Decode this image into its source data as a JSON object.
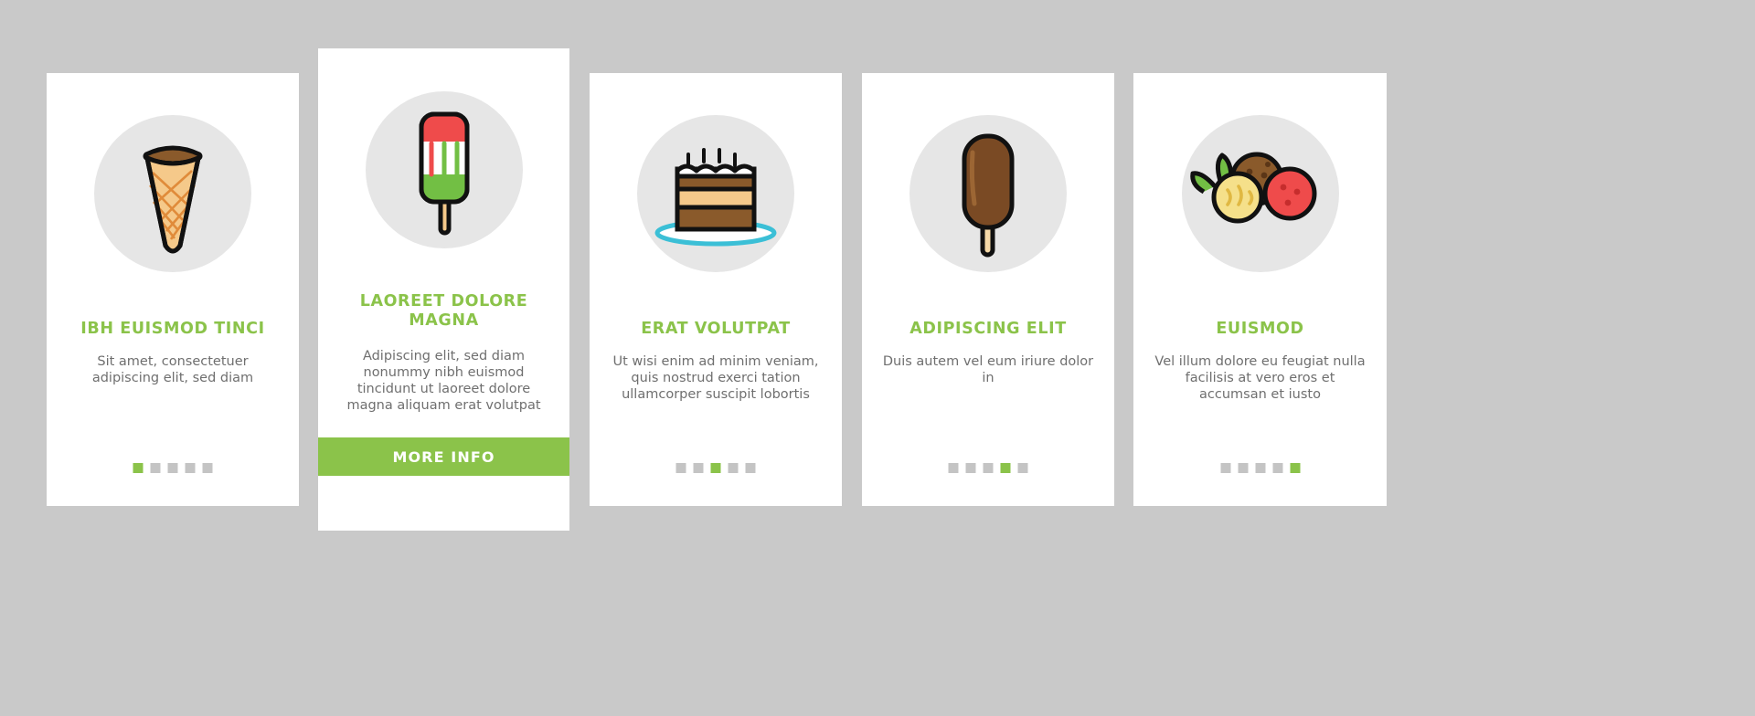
{
  "page": {
    "background_color": "#c9c9c9",
    "accent_color": "#8bc34a",
    "card_background": "#ffffff",
    "icon_circle_color": "#e6e6e6",
    "body_text_color": "#6f6f6f",
    "dot_inactive_color": "#c4c4c4"
  },
  "cards": [
    {
      "id": "card-1",
      "icon": "waffle-ice-cream-cone-icon",
      "title": "IBH EUISMOD TINCI",
      "body": "Sit amet, consectetuer adipiscing elit, sed diam",
      "dots": {
        "count": 5,
        "active_index": 0
      },
      "button": null
    },
    {
      "id": "card-2",
      "icon": "popsicle-ice-lolly-icon",
      "title": "LAOREET DOLORE MAGNA",
      "body": "Adipiscing elit, sed diam nonummy nibh euismod tincidunt ut laoreet dolore magna aliquam erat volutpat",
      "dots": null,
      "button": {
        "label": "MORE INFO",
        "name": "more-info-button"
      }
    },
    {
      "id": "card-3",
      "icon": "layer-cake-icon",
      "title": "ERAT VOLUTPAT",
      "body": "Ut wisi enim ad minim veniam, quis nostrud exerci tation ullamcorper suscipit lobortis",
      "dots": {
        "count": 5,
        "active_index": 2
      },
      "button": null
    },
    {
      "id": "card-4",
      "icon": "chocolate-ice-cream-bar-icon",
      "title": "ADIPISCING ELIT",
      "body": "Duis autem vel eum iriure dolor in",
      "dots": {
        "count": 5,
        "active_index": 3
      },
      "button": null
    },
    {
      "id": "card-5",
      "icon": "ice-cream-scoops-icon",
      "title": "EUISMOD",
      "body": "Vel illum dolore eu feugiat nulla facilisis at vero eros et accumsan et iusto",
      "dots": {
        "count": 5,
        "active_index": 4
      },
      "button": null
    }
  ]
}
